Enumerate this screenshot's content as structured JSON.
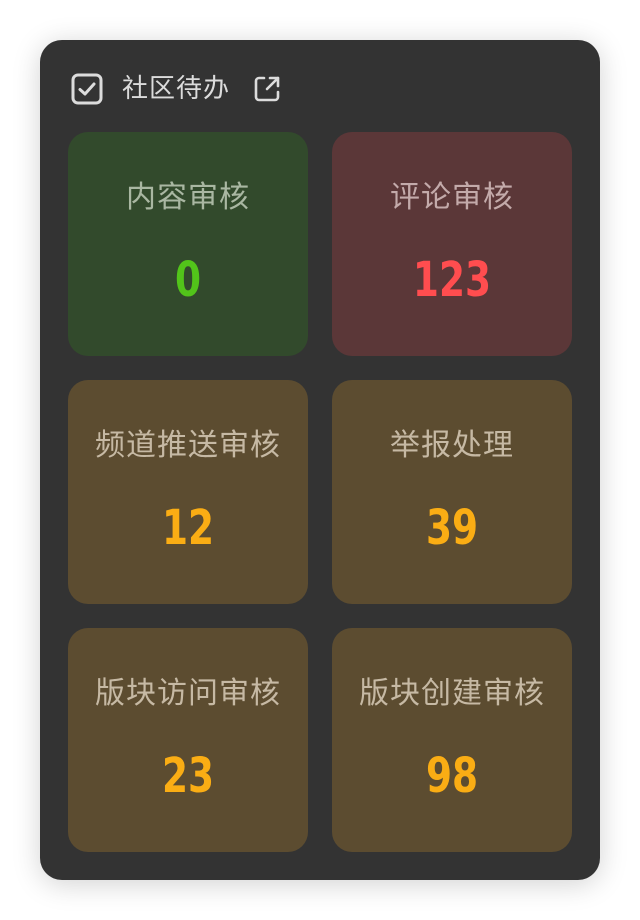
{
  "header": {
    "title": "社区待办",
    "icons": [
      "checkbox-icon",
      "external-link-icon"
    ]
  },
  "cards": [
    {
      "label": "内容审核",
      "value": "0",
      "bg": "#324a2c",
      "label_color": "#a9b7a2",
      "value_color": "#52c41a"
    },
    {
      "label": "评论审核",
      "value": "123",
      "bg": "#5b3738",
      "label_color": "#c3aaaa",
      "value_color": "#ff4d4f"
    },
    {
      "label": "频道推送审核",
      "value": "12",
      "bg": "#5c4c30",
      "label_color": "#c6b9a4",
      "value_color": "#faad14"
    },
    {
      "label": "举报处理",
      "value": "39",
      "bg": "#5c4c30",
      "label_color": "#c6b9a4",
      "value_color": "#faad14"
    },
    {
      "label": "版块访问审核",
      "value": "23",
      "bg": "#5c4c30",
      "label_color": "#c6b9a4",
      "value_color": "#faad14"
    },
    {
      "label": "版块创建审核",
      "value": "98",
      "bg": "#5c4c30",
      "label_color": "#c6b9a4",
      "value_color": "#faad14"
    }
  ],
  "colors": {
    "panel_bg": "#333333",
    "header_text": "#dcdcdc"
  }
}
